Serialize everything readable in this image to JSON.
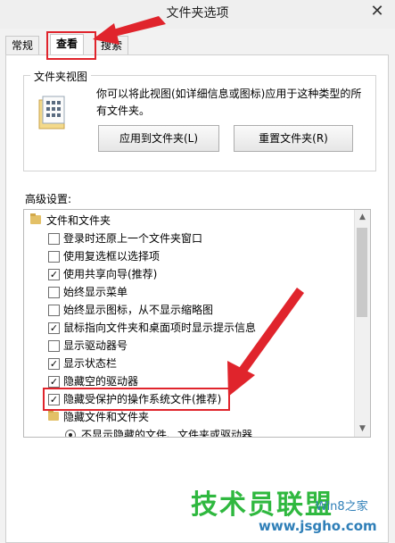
{
  "window": {
    "title": "文件夹选项",
    "close_glyph": "✕"
  },
  "tabs": [
    {
      "label": "常规"
    },
    {
      "label": "查看"
    },
    {
      "label": "搜索"
    }
  ],
  "folder_views": {
    "title": "文件夹视图",
    "description": "你可以将此视图(如详细信息或图标)应用于这种类型的所有文件夹。",
    "apply_button": "应用到文件夹(L)",
    "reset_button": "重置文件夹(R)"
  },
  "advanced": {
    "label": "高级设置:",
    "items": [
      {
        "kind": "folder",
        "label": "文件和文件夹",
        "level": 0
      },
      {
        "kind": "checkbox",
        "label": "登录时还原上一个文件夹窗口",
        "checked": false
      },
      {
        "kind": "checkbox",
        "label": "使用复选框以选择项",
        "checked": false
      },
      {
        "kind": "checkbox",
        "label": "使用共享向导(推荐)",
        "checked": true
      },
      {
        "kind": "checkbox",
        "label": "始终显示菜单",
        "checked": false
      },
      {
        "kind": "checkbox",
        "label": "始终显示图标，从不显示缩略图",
        "checked": false
      },
      {
        "kind": "checkbox",
        "label": "鼠标指向文件夹和桌面项时显示提示信息",
        "checked": true
      },
      {
        "kind": "checkbox",
        "label": "显示驱动器号",
        "checked": false
      },
      {
        "kind": "checkbox",
        "label": "显示状态栏",
        "checked": true
      },
      {
        "kind": "checkbox",
        "label": "隐藏空的驱动器",
        "checked": true
      },
      {
        "kind": "checkbox",
        "label": "隐藏受保护的操作系统文件(推荐)",
        "checked": true
      },
      {
        "kind": "folder",
        "label": "隐藏文件和文件夹",
        "level": 1
      },
      {
        "kind": "radio",
        "label": "不显示隐藏的文件、文件夹或驱动器",
        "checked": true
      }
    ]
  },
  "watermark": {
    "brand": "技术员联盟",
    "site": "www.jsgho.com",
    "sub": "Win8之家"
  },
  "colors": {
    "highlight": "#e0242c",
    "watermark_green": "#2fb83f"
  }
}
